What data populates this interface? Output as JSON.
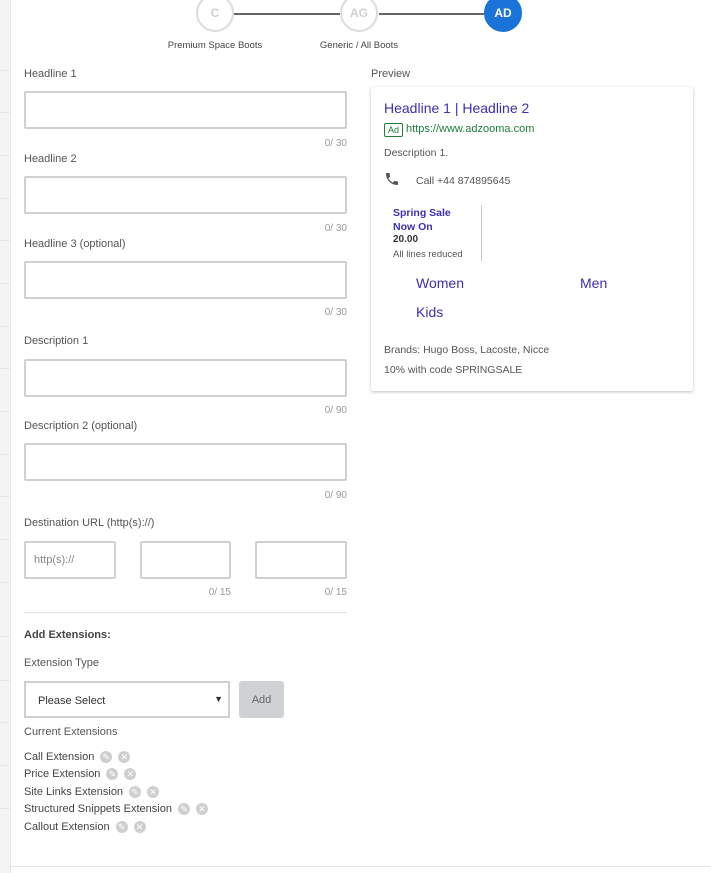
{
  "steps": [
    {
      "letter": "C",
      "label": "Premium Space Boots"
    },
    {
      "letter": "AG",
      "label": "Generic / All Boots"
    },
    {
      "letter": "AD",
      "label": ""
    }
  ],
  "form": {
    "headline1": {
      "label": "Headline 1",
      "counter": "0/ 30"
    },
    "headline2": {
      "label": "Headline 2",
      "counter": "0/ 30"
    },
    "headline3": {
      "label": "Headline 3 (optional)",
      "counter": "0/ 30"
    },
    "description1": {
      "label": "Description 1",
      "counter": "0/ 90"
    },
    "description2": {
      "label": "Description 2 (optional)",
      "counter": "0/ 90"
    },
    "destination": {
      "label": "Destination URL (http(s)://)",
      "protocol_placeholder": "http(s)://",
      "path1_counter": "0/ 15",
      "path2_counter": "0/ 15"
    }
  },
  "extensions": {
    "title": "Add Extensions:",
    "type_label": "Extension Type",
    "select_value": "Please Select",
    "add_label": "Add",
    "current_label": "Current Extensions",
    "items": [
      "Call Extension",
      "Price Extension",
      "Site Links Extension",
      "Structured Snippets Extension",
      "Callout Extension"
    ]
  },
  "preview": {
    "label": "Preview",
    "headline": "Headline 1 | Headline 2",
    "ad_badge": "Ad",
    "url": "https://www.adzooma.com",
    "description": "Description 1.",
    "phone": "Call +44 874895645",
    "price": {
      "header": "Spring Sale Now On",
      "value": "20.00",
      "desc": "All lines reduced"
    },
    "sitelinks": [
      "Women",
      "Men",
      "Kids"
    ],
    "snippet": "Brands: Hugo Boss, Lacoste, Nicce",
    "callout": "10% with code SPRINGSALE"
  },
  "colors": {
    "accent": "#1a73d9",
    "link": "#3b2fb3",
    "url_green": "#1e7d3a"
  }
}
